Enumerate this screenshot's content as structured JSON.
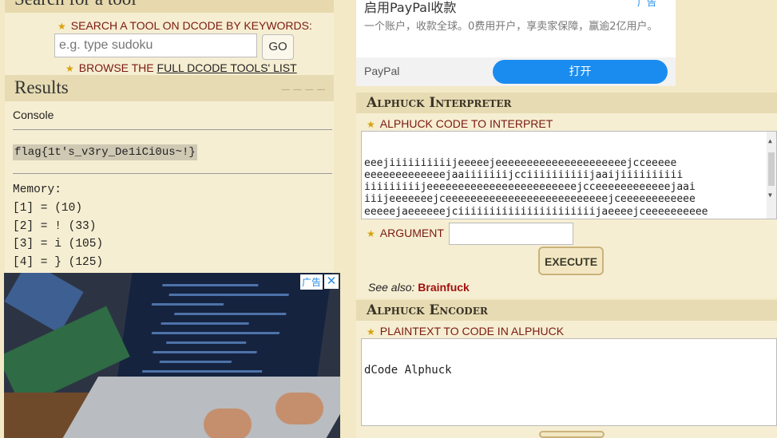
{
  "search": {
    "title": "Search for a tool",
    "keywords_label": "SEARCH A TOOL ON DCODE BY KEYWORDS:",
    "placeholder": "e.g. type sudoku",
    "go_label": "GO",
    "browse_prefix": "BROWSE THE ",
    "browse_link": "FULL DCODE TOOLS' LIST"
  },
  "results": {
    "title": "Results",
    "console_label": "Console",
    "flag": "flag{1t's_v3ry_De1iCi0us~!}",
    "memory_label": "Memory:",
    "memory": [
      "[1] = (10)",
      "[2] = ! (33)",
      "[3] = i (105)",
      "[4] = } (125)"
    ]
  },
  "left_ad": {
    "badge": "广告",
    "close": "✕"
  },
  "paypal_ad": {
    "title": "启用PayPal收款",
    "link": "广告",
    "description": "一个账户，收款全球。0费用开户，享卖家保障，赢逾2亿用户。",
    "brand": "PayPal",
    "open_label": "打开"
  },
  "interpreter": {
    "title": "Alphuck Interpreter",
    "code_label": "ALPHUCK CODE TO INTERPRET",
    "code": "eeejiiiiiiiiiijeeeeejeeeeeeeeeeeeeeeeeeeeejcceeeee\neeeeeeeeeeeeejaaiiiiiiijcciiiiiiiiiijaaijiiiiiiiiii\niiiiiiiiijeeeeeeeeeeeeeeeeeeeeeeeejcceeeeeeeeeeeejaai\niiijeeeeeeejceeeeeeeeeeeeeeeeeeeeeeeeeejceeeeeeeeeeee\neeeeejaeeeeeejciiiiiiiiiiiiiiiiiiiiiijaeeeejceeeeeeeeee\neeeeeeeejajciiiiiiiiiiiiiiiiiiiiijaaiiiijiijeeeeeeeeee\nejcciiiiiiiiiiiiiijaaij",
    "argument_label": "ARGUMENT",
    "execute_label": "EXECUTE",
    "see_also_label": "See also: ",
    "see_also_link": "Brainfuck"
  },
  "encoder": {
    "title": "Alphuck Encoder",
    "plaintext_label": "PLAINTEXT TO CODE IN ALPHUCK",
    "plaintext": "dCode Alphuck"
  }
}
